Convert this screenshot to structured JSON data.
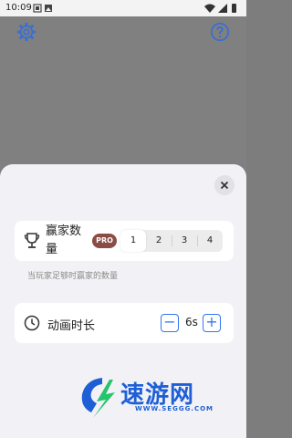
{
  "status_bar": {
    "time": "10:09"
  },
  "icons": {
    "settings": "gear-icon",
    "help": "question-circle-icon",
    "close": "close-icon",
    "trophy": "trophy-icon",
    "clock": "clock-icon"
  },
  "colors": {
    "accent": "#3377ee",
    "pro_badge": "#8a4d45",
    "sheet_bg": "#f2f2f6",
    "watermark": "#1e5fd6"
  },
  "winners": {
    "title": "赢家数量",
    "pro_label": "PRO",
    "options": [
      "1",
      "2",
      "3",
      "4"
    ],
    "selected": "1",
    "hint": "当玩家足够时赢家的数量"
  },
  "animation": {
    "title": "动画时长",
    "minus": "−",
    "value": "6s",
    "plus": "+"
  },
  "watermark": {
    "title": "速游网",
    "url": "WWW.SEGGG.COM"
  }
}
